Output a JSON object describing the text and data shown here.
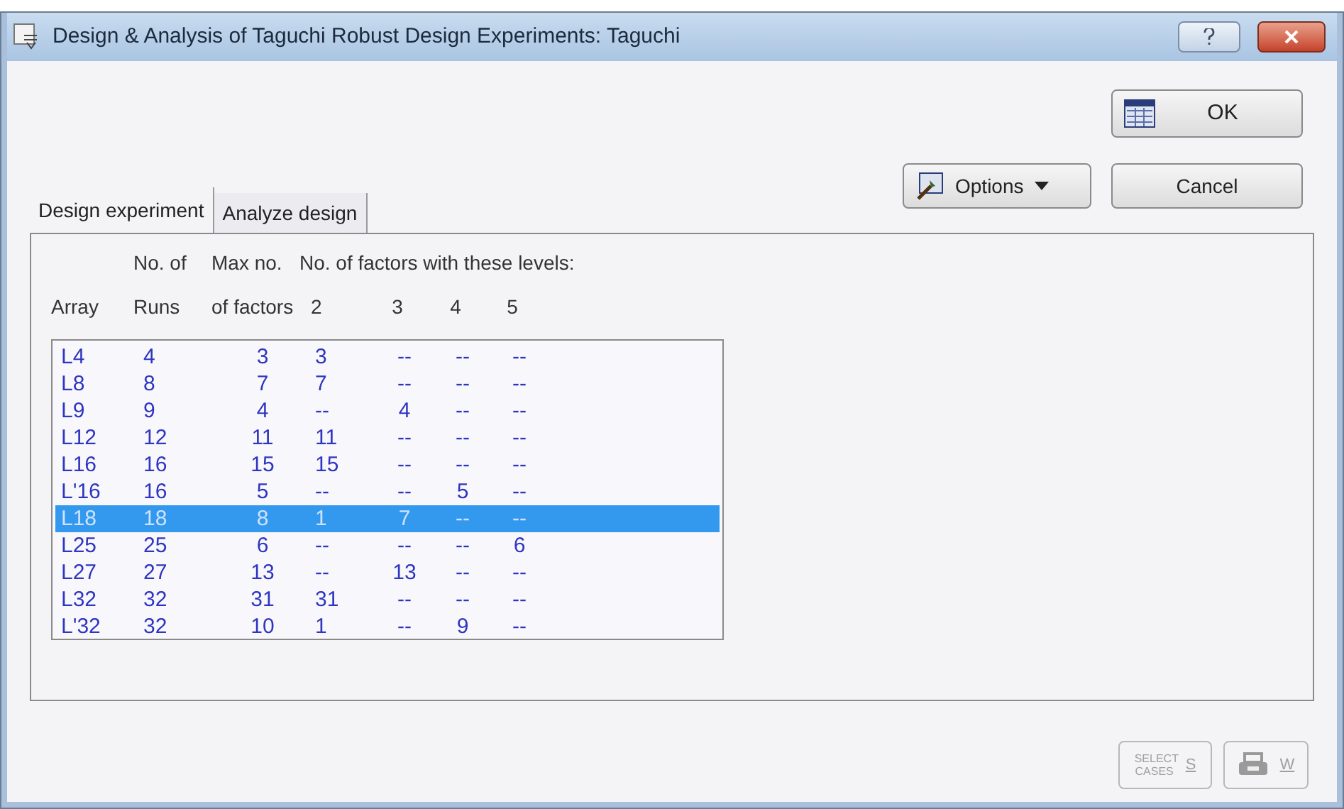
{
  "window": {
    "title": "Design & Analysis of Taguchi Robust Design Experiments: Taguchi"
  },
  "buttons": {
    "ok": "OK",
    "options": "Options",
    "cancel": "Cancel",
    "select_cases": "SELECT CASES",
    "select_cases_key": "S",
    "print_key": "W"
  },
  "tabs": [
    {
      "label": "Design experiment",
      "selected": true
    },
    {
      "label": "Analyze design",
      "selected": false
    }
  ],
  "table": {
    "header_top": [
      "No. of",
      "Max no.",
      "No. of factors with these levels:"
    ],
    "columns": [
      "Array",
      "Runs",
      "of factors",
      "2",
      "3",
      "4",
      "5"
    ],
    "rows": [
      {
        "cells": [
          "L4",
          "4",
          "3",
          "3",
          "--",
          "--",
          "--"
        ],
        "selected": false
      },
      {
        "cells": [
          "L8",
          "8",
          "7",
          "7",
          "--",
          "--",
          "--"
        ],
        "selected": false
      },
      {
        "cells": [
          "L9",
          "9",
          "4",
          "--",
          "4",
          "--",
          "--"
        ],
        "selected": false
      },
      {
        "cells": [
          "L12",
          "12",
          "11",
          "11",
          "--",
          "--",
          "--"
        ],
        "selected": false
      },
      {
        "cells": [
          "L16",
          "16",
          "15",
          "15",
          "--",
          "--",
          "--"
        ],
        "selected": false
      },
      {
        "cells": [
          "L'16",
          "16",
          "5",
          "--",
          "--",
          "5",
          "--"
        ],
        "selected": false
      },
      {
        "cells": [
          "L18",
          "18",
          "8",
          "1",
          "7",
          "--",
          "--"
        ],
        "selected": true
      },
      {
        "cells": [
          "L25",
          "25",
          "6",
          "--",
          "--",
          "--",
          "6"
        ],
        "selected": false
      },
      {
        "cells": [
          "L27",
          "27",
          "13",
          "--",
          "13",
          "--",
          "--"
        ],
        "selected": false
      },
      {
        "cells": [
          "L32",
          "32",
          "31",
          "31",
          "--",
          "--",
          "--"
        ],
        "selected": false
      },
      {
        "cells": [
          "L'32",
          "32",
          "10",
          "1",
          "--",
          "9",
          "--"
        ],
        "selected": false
      }
    ]
  }
}
